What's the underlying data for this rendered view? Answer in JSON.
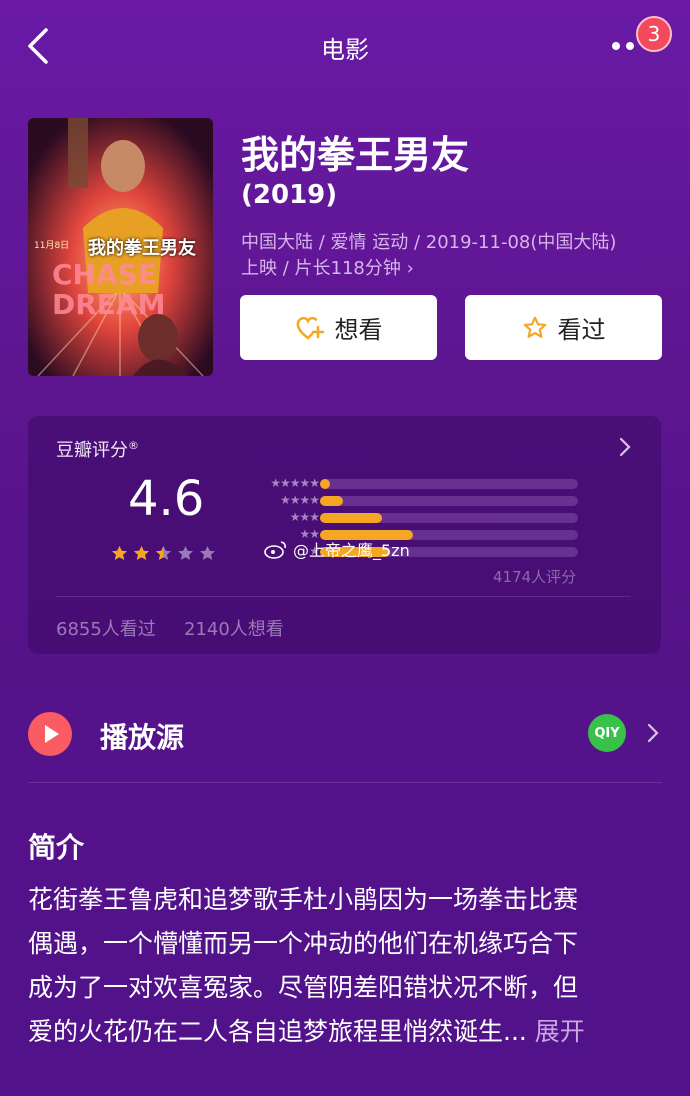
{
  "nav": {
    "title": "电影",
    "badge_count": "3",
    "back_icon": "chevron-left-icon",
    "more_icon": "more-dots-icon"
  },
  "poster": {
    "release_date": "11月8日",
    "cn_title": "我的拳王男友",
    "en_title_lines": [
      "CHASE",
      "DREAM"
    ]
  },
  "movie": {
    "title": "我的拳王男友",
    "year": "(2019)",
    "meta_line1": "中国大陆 / 爱情 运动 / 2019-11-08(中国大陆)",
    "meta_line2": "上映 / 片长118分钟 ›"
  },
  "actions": {
    "want_label": "想看",
    "want_icon": "heart-plus-icon",
    "seen_label": "看过",
    "seen_icon": "star-outline-icon"
  },
  "rating": {
    "label": "豆瓣评分",
    "label_mark": "®",
    "score": "4.6",
    "stars_value": 2.5,
    "stars_max": 5,
    "distribution": [
      {
        "stars": "★★★★★",
        "fraction": 0.04
      },
      {
        "stars": "★★★★",
        "fraction": 0.09
      },
      {
        "stars": "★★★",
        "fraction": 0.24
      },
      {
        "stars": "★★",
        "fraction": 0.36
      },
      {
        "stars": "★",
        "fraction": 0.27
      }
    ],
    "total": "4174人评分",
    "seen": "6855人看过",
    "want": "2140人想看",
    "accent_color": "#f5a623"
  },
  "watermark": "@上帝之鹰_5zn",
  "play_source": {
    "label": "播放源",
    "provider_icon": "iqiyi-icon",
    "provider_text": "QIY"
  },
  "intro": {
    "title": "简介",
    "lines": [
      "花街拳王鲁虎和追梦歌手杜小鹃因为一场拳击比赛",
      "偶遇，一个懵懂而另一个冲动的他们在机缘巧合下",
      "成为了一对欢喜冤家。尽管阴差阳错状况不断，但",
      "爱的火花仍在二人各自追梦旅程里悄然诞生..."
    ],
    "expand": "展开"
  }
}
